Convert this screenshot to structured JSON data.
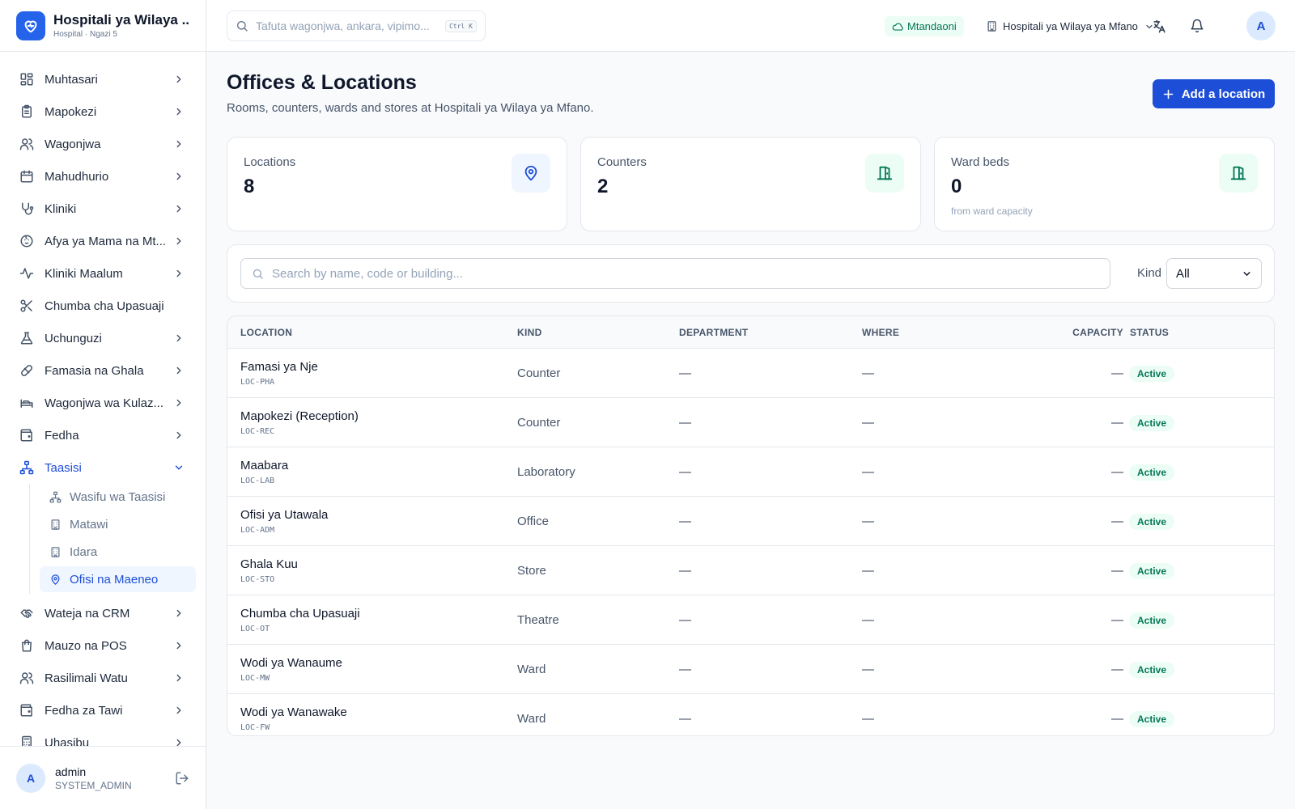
{
  "app": {
    "name": "Hospitali ya Wilaya ...",
    "subtitle": "Hospital · Ngazi 5"
  },
  "sidebar": {
    "items": [
      {
        "label": "Muhtasari",
        "icon": "dashboard-icon"
      },
      {
        "label": "Mapokezi",
        "icon": "clipboard-icon"
      },
      {
        "label": "Wagonjwa",
        "icon": "users-icon"
      },
      {
        "label": "Mahudhurio",
        "icon": "calendar-icon"
      },
      {
        "label": "Kliniki",
        "icon": "stethoscope-icon"
      },
      {
        "label": "Afya ya Mama na Mt...",
        "icon": "baby-icon"
      },
      {
        "label": "Kliniki Maalum",
        "icon": "activity-icon"
      },
      {
        "label": "Chumba cha Upasuaji",
        "icon": "scissors-icon"
      },
      {
        "label": "Uchunguzi",
        "icon": "flask-icon"
      },
      {
        "label": "Famasia na Ghala",
        "icon": "pill-icon"
      },
      {
        "label": "Wagonjwa wa Kulaz...",
        "icon": "bed-icon"
      },
      {
        "label": "Fedha",
        "icon": "wallet-icon"
      },
      {
        "label": "Taasisi",
        "icon": "org-icon"
      }
    ],
    "taasisi_sub": [
      {
        "label": "Wasifu wa Taasisi",
        "icon": "org-icon"
      },
      {
        "label": "Matawi",
        "icon": "building-icon"
      },
      {
        "label": "Idara",
        "icon": "building-icon"
      },
      {
        "label": "Ofisi na Maeneo",
        "icon": "map-pin-icon"
      }
    ],
    "items_after": [
      {
        "label": "Wateja na CRM",
        "icon": "handshake-icon"
      },
      {
        "label": "Mauzo na POS",
        "icon": "shopping-bag-icon"
      },
      {
        "label": "Rasilimali Watu",
        "icon": "users-icon"
      },
      {
        "label": "Fedha za Tawi",
        "icon": "wallet-icon"
      },
      {
        "label": "Uhasibu",
        "icon": "calculator-icon"
      }
    ],
    "user": {
      "avatar": "A",
      "name": "admin",
      "role": "SYSTEM_ADMIN"
    }
  },
  "topbar": {
    "search_placeholder": "Tafuta wagonjwa, ankara, vipimo...",
    "shortcut": "Ctrl K",
    "online_label": "Mtandaoni",
    "branch_label": "Hospitali ya Wilaya ya Mfano",
    "avatar": "A"
  },
  "page": {
    "title": "Offices & Locations",
    "subtitle": "Rooms, counters, wards and stores at Hospitali ya Wilaya ya Mfano.",
    "add_button": "Add a location"
  },
  "stats": [
    {
      "label": "Locations",
      "value": "8",
      "note": "",
      "icon": "map-pin-icon",
      "color": "#1d4ed8",
      "bg": "#eff6ff"
    },
    {
      "label": "Counters",
      "value": "2",
      "note": "",
      "icon": "door-icon",
      "color": "#047857",
      "bg": "#ecfdf5"
    },
    {
      "label": "Ward beds",
      "value": "0",
      "note": "from ward capacity",
      "icon": "door-icon",
      "color": "#047857",
      "bg": "#ecfdf5"
    }
  ],
  "filters": {
    "search_placeholder": "Search by name, code or building...",
    "kind_label": "Kind",
    "kind_value": "All"
  },
  "table": {
    "columns": [
      "LOCATION",
      "KIND",
      "DEPARTMENT",
      "WHERE",
      "CAPACITY",
      "STATUS"
    ],
    "rows": [
      {
        "name": "Famasi ya Nje",
        "code": "LOC-PHA",
        "kind": "Counter",
        "department": "—",
        "where": "—",
        "capacity": "—",
        "status": "Active"
      },
      {
        "name": "Mapokezi (Reception)",
        "code": "LOC-REC",
        "kind": "Counter",
        "department": "—",
        "where": "—",
        "capacity": "—",
        "status": "Active"
      },
      {
        "name": "Maabara",
        "code": "LOC-LAB",
        "kind": "Laboratory",
        "department": "—",
        "where": "—",
        "capacity": "—",
        "status": "Active"
      },
      {
        "name": "Ofisi ya Utawala",
        "code": "LOC-ADM",
        "kind": "Office",
        "department": "—",
        "where": "—",
        "capacity": "—",
        "status": "Active"
      },
      {
        "name": "Ghala Kuu",
        "code": "LOC-STO",
        "kind": "Store",
        "department": "—",
        "where": "—",
        "capacity": "—",
        "status": "Active"
      },
      {
        "name": "Chumba cha Upasuaji",
        "code": "LOC-OT",
        "kind": "Theatre",
        "department": "—",
        "where": "—",
        "capacity": "—",
        "status": "Active"
      },
      {
        "name": "Wodi ya Wanaume",
        "code": "LOC-MW",
        "kind": "Ward",
        "department": "—",
        "where": "—",
        "capacity": "—",
        "status": "Active"
      },
      {
        "name": "Wodi ya Wanawake",
        "code": "LOC-FW",
        "kind": "Ward",
        "department": "—",
        "where": "—",
        "capacity": "—",
        "status": "Active"
      }
    ]
  },
  "colors": {
    "accent": "#1d4ed8",
    "active_badge_bg": "#ecfdf5",
    "active_badge_text": "#047857"
  }
}
